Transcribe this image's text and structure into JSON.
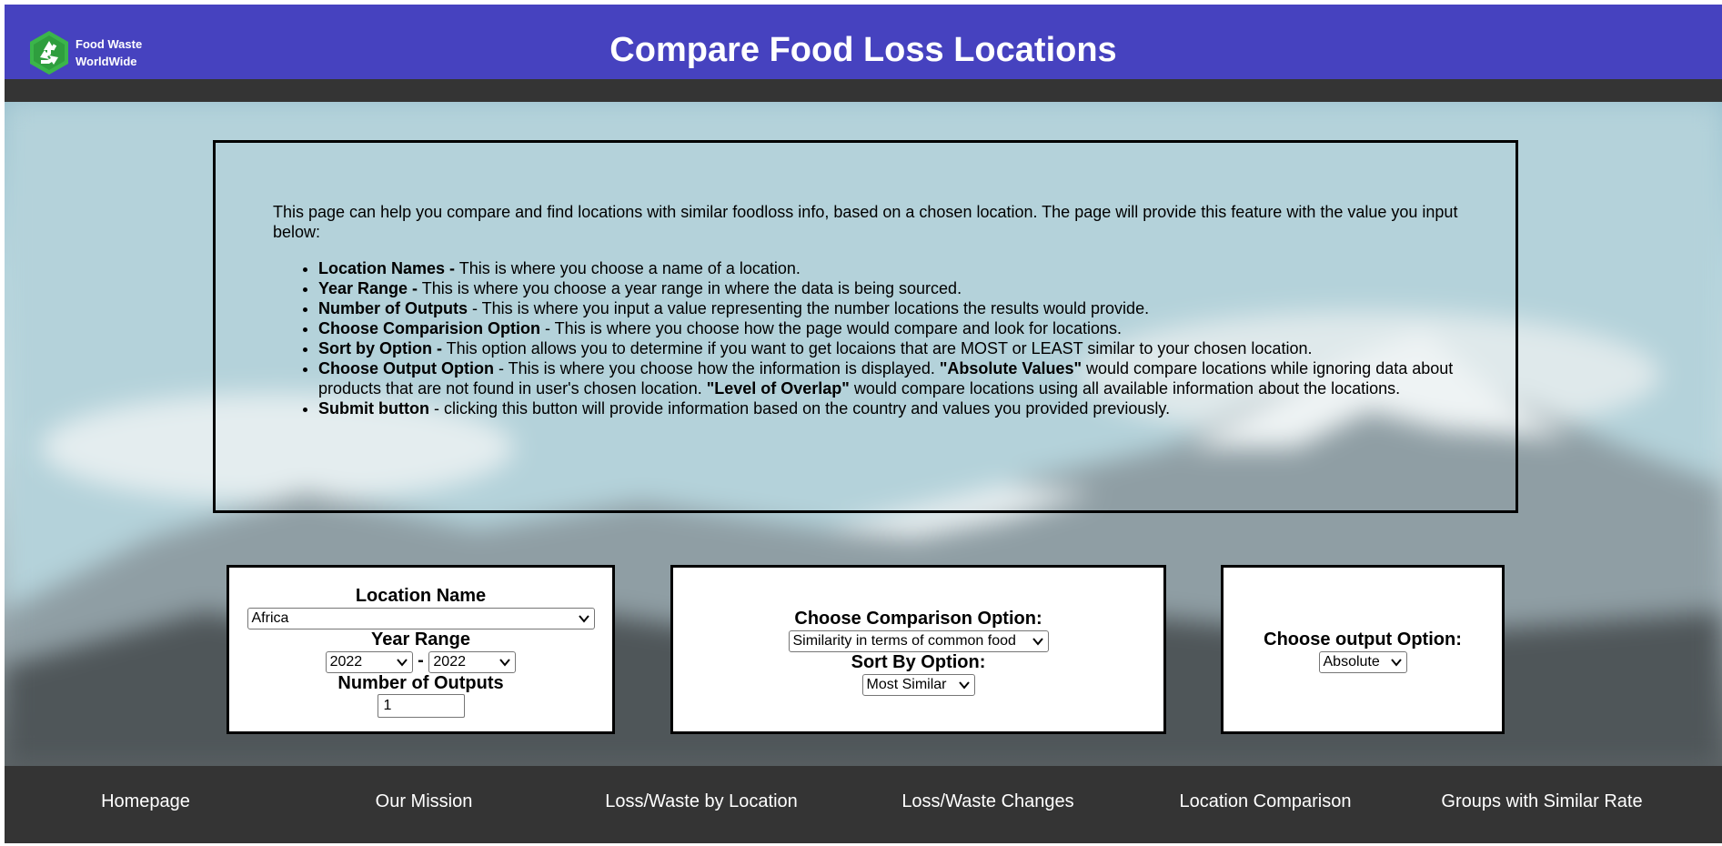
{
  "header": {
    "logo_line1": "Food Waste",
    "logo_line2": "WorldWide",
    "title": "Compare Food Loss Locations"
  },
  "colors": {
    "header_bg": "#4642bf",
    "dark_bar": "#343434",
    "logo_green": "#3bb54a"
  },
  "info": {
    "intro": "This page can help you compare and find locations with similar foodloss info, based on a chosen location. The page will provide this feature with the value you input below:",
    "items": [
      {
        "term": "Location Names -",
        "desc": " This is where you choose a name of a location."
      },
      {
        "term": "Year Range -",
        "desc": " This is where you choose a year range in where the data is being sourced."
      },
      {
        "term": "Number of Outputs",
        "desc": " - This is where you input a value representing the number locations the results would provide."
      },
      {
        "term": "Choose Comparision Option",
        "desc": " - This is where you choose how the page would compare and look for locations."
      },
      {
        "term": "Sort by Option -",
        "desc": " This option allows you to determine if you want to get locaions that are MOST or LEAST similar to your chosen location."
      },
      {
        "term": "Choose Output Option",
        "desc": " - This is where you choose how the information is displayed. ",
        "term2": "\"Absolute Values\"",
        "desc2": " would compare locations while ignoring data about products that are not found in user's chosen location. ",
        "term3": "\"Level of Overlap\"",
        "desc3": " would compare locations using all available information about the locations."
      },
      {
        "term": "Submit button",
        "desc": " - clicking this button will provide information based on the country and values you provided previously."
      }
    ]
  },
  "form": {
    "location_label": "Location Name",
    "location_value": "Africa",
    "year_label": "Year Range",
    "year_start": "2022",
    "year_sep": "-",
    "year_end": "2022",
    "outputs_label": "Number of Outputs",
    "outputs_value": "1",
    "comparison_label": "Choose Comparison Option:",
    "comparison_value": "Similarity in terms of common food",
    "sort_label": "Sort By Option:",
    "sort_value": "Most Similar",
    "output_label": "Choose output Option:",
    "output_value": "Absolute"
  },
  "footer": {
    "links": [
      "Homepage",
      "Our Mission",
      "Loss/Waste by Location",
      "Loss/Waste Changes",
      "Location Comparison",
      "Groups with Similar Rate"
    ]
  }
}
